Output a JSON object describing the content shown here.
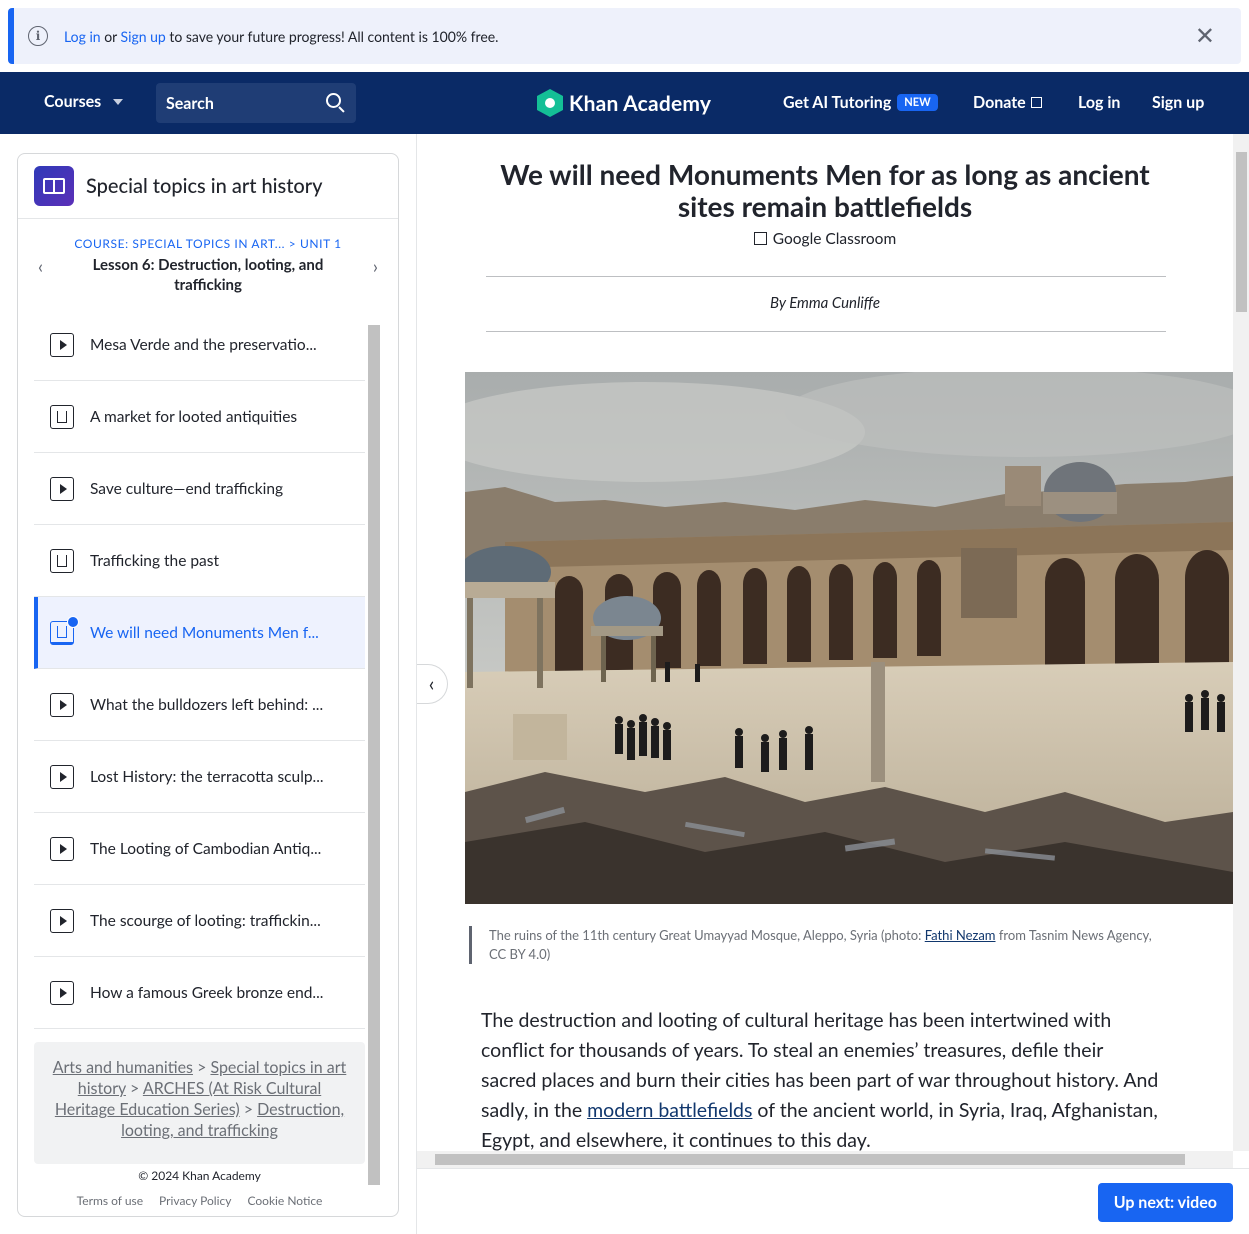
{
  "banner": {
    "login": "Log in",
    "or": " or ",
    "signup": "Sign up",
    "message": " to save your future progress! All content is 100% free.",
    "close": "✕"
  },
  "nav": {
    "courses": "Courses",
    "search": "Search",
    "logo": "Khan Academy",
    "ai_tutoring": "Get AI Tutoring",
    "new_badge": "NEW",
    "donate": "Donate",
    "login": "Log in",
    "signup": "Sign up"
  },
  "sidebar": {
    "course_title": "Special topics in art history",
    "crumb_course": "COURSE: SPECIAL TOPICS IN ART...",
    "crumb_sep": " > ",
    "crumb_unit": "UNIT 1",
    "lesson_title": "Lesson 6: Destruction, looting, and trafficking",
    "prev": "‹",
    "next": "›",
    "items": [
      {
        "label": "Mesa Verde and the preservatio...",
        "type": "video"
      },
      {
        "label": "A market for looted antiquities",
        "type": "article"
      },
      {
        "label": "Save culture—end trafficking",
        "type": "video"
      },
      {
        "label": "Trafficking the past",
        "type": "article"
      },
      {
        "label": "We will need Monuments Men f...",
        "type": "article"
      },
      {
        "label": "What the bulldozers left behind: ...",
        "type": "video"
      },
      {
        "label": "Lost History: the terracotta sculp...",
        "type": "video"
      },
      {
        "label": "The Looting of Cambodian Antiq...",
        "type": "video"
      },
      {
        "label": "The scourge of looting: traffickin...",
        "type": "video"
      },
      {
        "label": "How a famous Greek bronze end...",
        "type": "video"
      }
    ],
    "breadcrumb": {
      "arts": "Arts and humanities",
      "special": "Special topics in art history",
      "arches": "ARCHES (At Risk Cultural Heritage Education Series)",
      "destruction": "Destruction, looting, and trafficking",
      "sep": " > "
    },
    "footer": {
      "copyright": "© 2024 Khan Academy",
      "terms": "Terms of use",
      "privacy": "Privacy Policy",
      "cookie": "Cookie Notice"
    }
  },
  "article": {
    "title": "We will need Monuments Men for as long as ancient sites remain battlefields",
    "google_classroom": "Google Classroom",
    "byline": "By Emma Cunliffe",
    "caption_pre": "The ruins of the 11th century Great Umayyad Mosque, Aleppo, Syria (photo: ",
    "caption_link": "Fathi Nezam",
    "caption_post": " from Tasnim News Agency, CC BY 4.0)",
    "body_pre": "The destruction and looting of cultural heritage has been intertwined with conflict for thousands of years. To steal an enemies’ treasures, defile their sacred places and burn their cities has been part of war throughout history. And sadly, in the ",
    "body_link": "modern battlefields",
    "body_post": " of the ancient world, in Syria, Iraq, Afghanistan, Egypt, and elsewhere, it continues to this day.",
    "up_next": "Up next: video"
  }
}
